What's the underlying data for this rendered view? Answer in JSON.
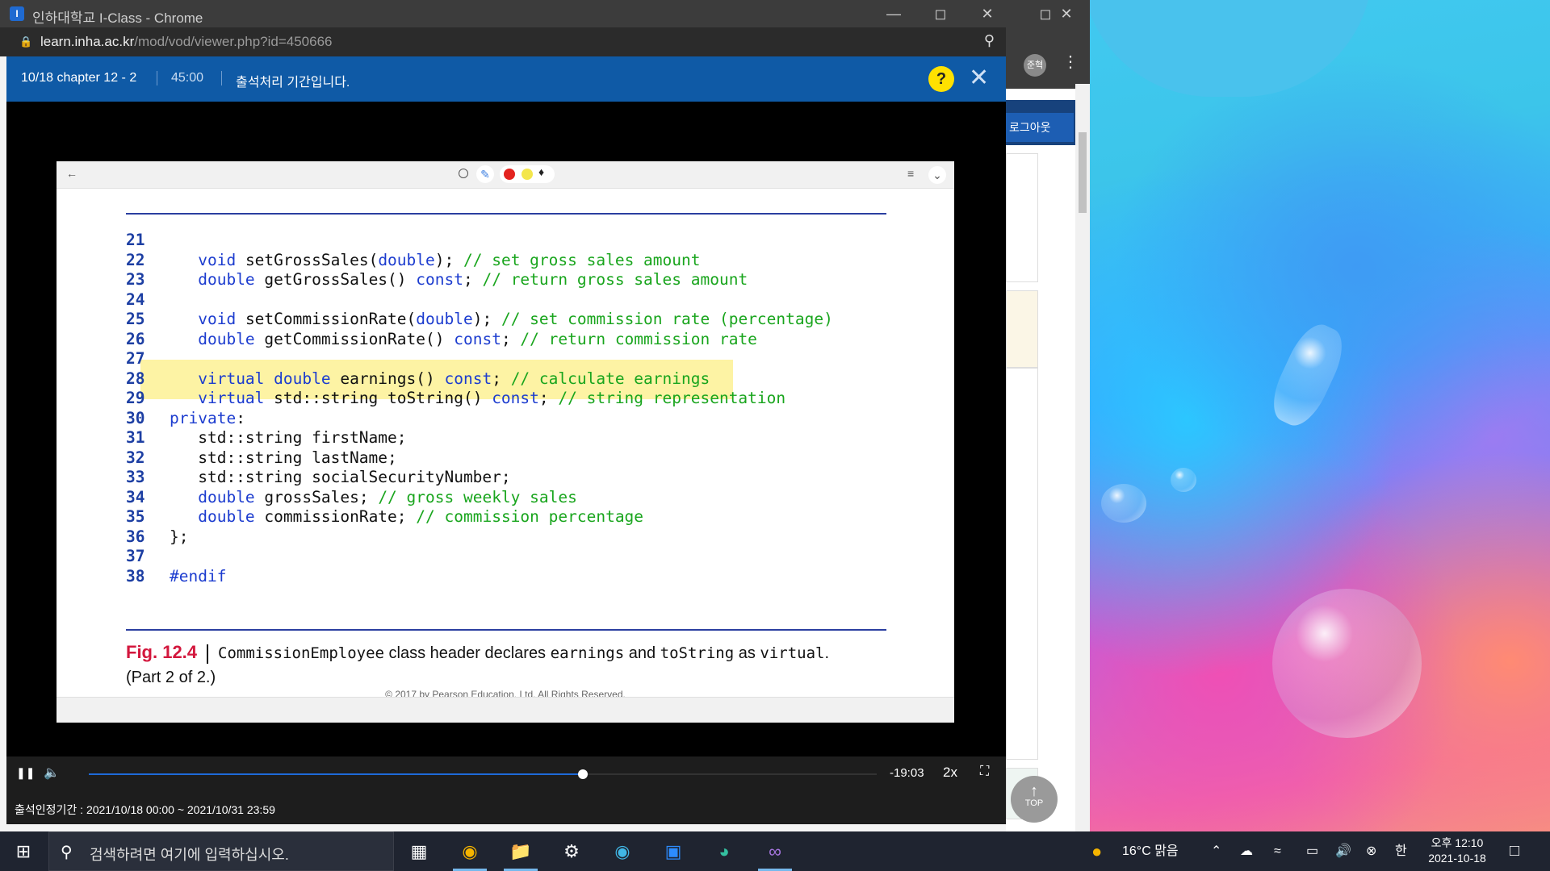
{
  "window": {
    "title": "인하대학교 I-Class - Chrome",
    "url_host": "learn.inha.ac.kr",
    "url_path": "/mod/vod/viewer.php?id=450666",
    "favicon": "I"
  },
  "outer_page": {
    "avatar_text": "준혁",
    "logout_label": "로그아웃",
    "top_label": "TOP"
  },
  "vod": {
    "lesson": "10/18 chapter 12 - 2",
    "duration": "45:00",
    "notice": "출석처리 기간입니다.",
    "help": "?"
  },
  "code_lines": [
    {
      "n": "21",
      "parts": []
    },
    {
      "n": "22",
      "parts": [
        {
          "t": "   "
        },
        {
          "t": "void",
          "c": "kw"
        },
        {
          "t": " setGrossSales("
        },
        {
          "t": "double",
          "c": "kw"
        },
        {
          "t": "); "
        },
        {
          "t": "// set gross sales amount",
          "c": "cm"
        }
      ]
    },
    {
      "n": "23",
      "parts": [
        {
          "t": "   "
        },
        {
          "t": "double",
          "c": "kw"
        },
        {
          "t": " getGrossSales() "
        },
        {
          "t": "const",
          "c": "kw"
        },
        {
          "t": "; "
        },
        {
          "t": "// return gross sales amount",
          "c": "cm"
        }
      ]
    },
    {
      "n": "24",
      "parts": []
    },
    {
      "n": "25",
      "parts": [
        {
          "t": "   "
        },
        {
          "t": "void",
          "c": "kw"
        },
        {
          "t": " setCommissionRate("
        },
        {
          "t": "double",
          "c": "kw"
        },
        {
          "t": "); "
        },
        {
          "t": "// set commission rate (percentage)",
          "c": "cm"
        }
      ]
    },
    {
      "n": "26",
      "parts": [
        {
          "t": "   "
        },
        {
          "t": "double",
          "c": "kw"
        },
        {
          "t": " getCommissionRate() "
        },
        {
          "t": "const",
          "c": "kw"
        },
        {
          "t": "; "
        },
        {
          "t": "// return commission rate",
          "c": "cm"
        }
      ]
    },
    {
      "n": "27",
      "parts": []
    },
    {
      "n": "28",
      "parts": [
        {
          "t": "   "
        },
        {
          "t": "virtual double",
          "c": "kw"
        },
        {
          "t": " earnings() "
        },
        {
          "t": "const",
          "c": "kw"
        },
        {
          "t": "; "
        },
        {
          "t": "// calculate earnings",
          "c": "cm"
        }
      ]
    },
    {
      "n": "29",
      "parts": [
        {
          "t": "   "
        },
        {
          "t": "virtual",
          "c": "kw"
        },
        {
          "t": " std::string toString() "
        },
        {
          "t": "const",
          "c": "kw"
        },
        {
          "t": "; "
        },
        {
          "t": "// string representation",
          "c": "cm"
        }
      ]
    },
    {
      "n": "30",
      "parts": [
        {
          "t": "private",
          "c": "kw"
        },
        {
          "t": ":"
        }
      ]
    },
    {
      "n": "31",
      "parts": [
        {
          "t": "   std::string firstName;"
        }
      ]
    },
    {
      "n": "32",
      "parts": [
        {
          "t": "   std::string lastName;"
        }
      ]
    },
    {
      "n": "33",
      "parts": [
        {
          "t": "   std::string socialSecurityNumber;"
        }
      ]
    },
    {
      "n": "34",
      "parts": [
        {
          "t": "   "
        },
        {
          "t": "double",
          "c": "kw"
        },
        {
          "t": " grossSales; "
        },
        {
          "t": "// gross weekly sales",
          "c": "cm"
        }
      ]
    },
    {
      "n": "35",
      "parts": [
        {
          "t": "   "
        },
        {
          "t": "double",
          "c": "kw"
        },
        {
          "t": " commissionRate; "
        },
        {
          "t": "// commission percentage",
          "c": "cm"
        }
      ]
    },
    {
      "n": "36",
      "parts": [
        {
          "t": "};"
        }
      ]
    },
    {
      "n": "37",
      "parts": []
    },
    {
      "n": "38",
      "parts": [
        {
          "t": "#endif",
          "c": "kw"
        }
      ]
    }
  ],
  "caption": {
    "fig": "Fig. 12.4",
    "class_name": "CommissionEmployee",
    "text1": " class header declares ",
    "m1": "earnings",
    "text2": " and ",
    "m2": "toString",
    "text3": " as ",
    "m3": "virtual",
    "text4": ".",
    "line2": "(Part 2 of 2.)"
  },
  "copyright": "© 2017 by Pearson Education, Ltd. All Rights Reserved.",
  "player": {
    "remaining": "-19:03",
    "speed": "2x",
    "progress": 0.627
  },
  "footer": "출석인정기간 : 2021/10/18 00:00 ~ 2021/10/31 23:59",
  "taskbar": {
    "search_placeholder": "검색하려면 여기에 입력하십시오.",
    "weather": "16°C  맑음",
    "ime": "한",
    "time": "오후 12:10",
    "date": "2021-10-18"
  },
  "icons": [
    "search-icon",
    "lock-icon",
    "zoom-icon",
    "kebab-icon",
    "close-icon",
    "minimize-icon",
    "maximize-icon",
    "back-arrow-icon",
    "circle-tool-icon",
    "pen-tool-icon",
    "red-color-icon",
    "yellow-color-icon",
    "eraser-icon",
    "list-icon",
    "chevron-down-icon",
    "pause-icon",
    "volume-icon",
    "fullscreen-icon",
    "windows-start-icon",
    "task-view-icon",
    "chrome-icon",
    "folder-icon",
    "settings-icon",
    "zoom-app-icon",
    "edge-icon",
    "visual-studio-icon",
    "weather-icon",
    "notification-icon"
  ]
}
